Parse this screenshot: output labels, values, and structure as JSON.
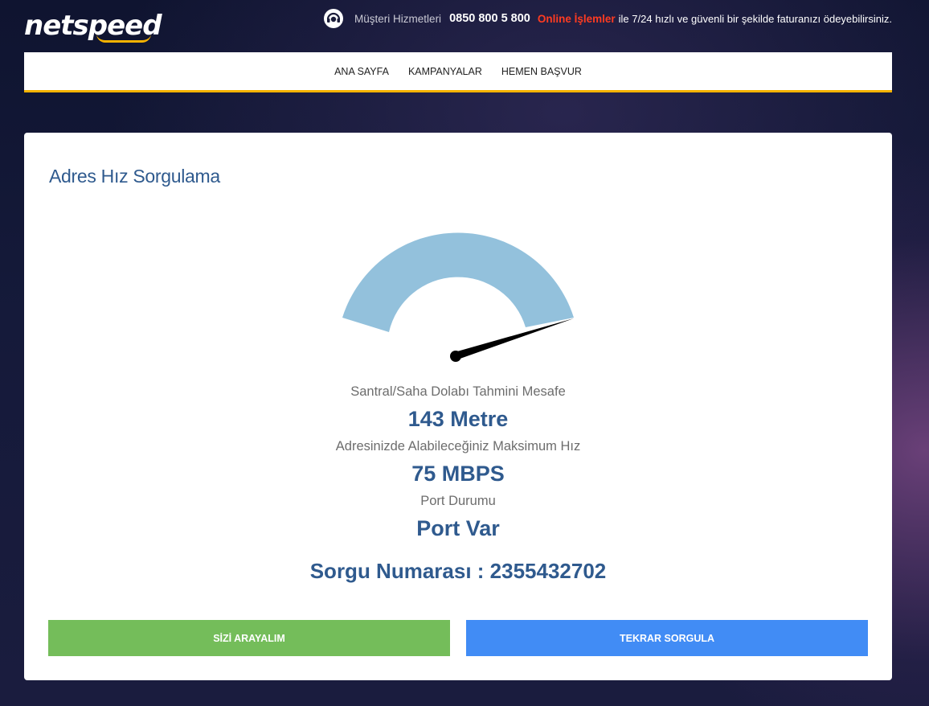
{
  "brand": {
    "logo_text": "netspeed"
  },
  "topbar": {
    "customer_service_label": "Müşteri Hizmetleri",
    "phone": "0850 800 5 800",
    "online_label": "Online İşlemler",
    "tagline": "ile 7/24 hızlı ve güvenli bir şekilde faturanızı ödeyebilirsiniz.",
    "icon": "headset-icon"
  },
  "nav": {
    "items": [
      {
        "label": "ANA SAYFA"
      },
      {
        "label": "KAMPANYALAR"
      },
      {
        "label": "HEMEN BAŞVUR"
      }
    ]
  },
  "card": {
    "title": "Adres Hız Sorgulama",
    "gauge": {
      "color": "#93c1dc",
      "needle_color": "#000000"
    },
    "results": [
      {
        "label": "Santral/Saha Dolabı Tahmini Mesafe",
        "value": "143 Metre"
      },
      {
        "label": "Adresinizde Alabileceğiniz Maksimum Hız",
        "value": "75 MBPS"
      },
      {
        "label": "Port Durumu",
        "value": "Port Var"
      }
    ],
    "query_number": "Sorgu Numarası : 2355432702",
    "buttons": {
      "call_label": "SİZİ ARAYALIM",
      "retry_label": "TEKRAR SORGULA"
    }
  },
  "colors": {
    "accent_yellow": "#f5b200",
    "title_blue": "#2f5a8e",
    "green_button": "#74bd5a",
    "blue_button": "#418cf5",
    "online_red": "#ff3b21"
  }
}
